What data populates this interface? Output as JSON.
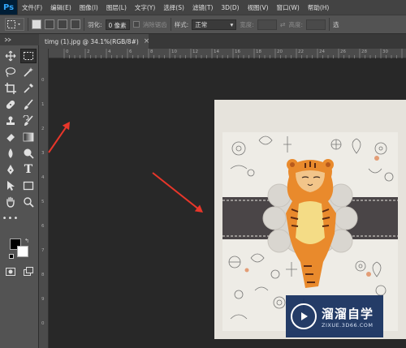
{
  "app": {
    "logo": "Ps"
  },
  "menu": [
    "文件(F)",
    "编辑(E)",
    "图像(I)",
    "图层(L)",
    "文字(Y)",
    "选择(S)",
    "滤镜(T)",
    "3D(D)",
    "视图(V)",
    "窗口(W)",
    "帮助(H)"
  ],
  "options": {
    "feather_label": "羽化:",
    "feather_value": "0 像素",
    "antialias_label": "消除锯齿",
    "style_label": "样式:",
    "style_value": "正常",
    "width_label": "宽度:",
    "height_label": "高度:",
    "select_label": "选"
  },
  "document_tab": {
    "title": "timg (1).jpg @ 34.1%(RGB/8#)",
    "close": "×"
  },
  "rulers": {
    "horizontal": [
      "0",
      "2",
      "4",
      "6",
      "8",
      "10",
      "12",
      "14",
      "16",
      "18",
      "20",
      "22",
      "24",
      "26",
      "28",
      "30"
    ],
    "vertical": [
      "0",
      "1",
      "2",
      "3",
      "4",
      "5",
      "6",
      "7",
      "8",
      "9",
      "0"
    ]
  },
  "tools": [
    "move-tool",
    "marquee-tool",
    "lasso-tool",
    "magic-wand-tool",
    "crop-tool",
    "eyedropper-tool",
    "healing-brush-tool",
    "brush-tool",
    "clone-stamp-tool",
    "history-brush-tool",
    "eraser-tool",
    "gradient-tool",
    "blur-tool",
    "dodge-tool",
    "pen-tool",
    "type-tool",
    "path-selection-tool",
    "rectangle-tool",
    "hand-tool",
    "zoom-tool",
    "more-tools"
  ],
  "colors": {
    "foreground": "#000000",
    "background": "#ffffff",
    "arrow": "#e8362a",
    "ps_blue": "#31a8ff"
  },
  "watermark": {
    "name": "溜溜自学",
    "url": "ZIXUE.3D66.COM"
  }
}
